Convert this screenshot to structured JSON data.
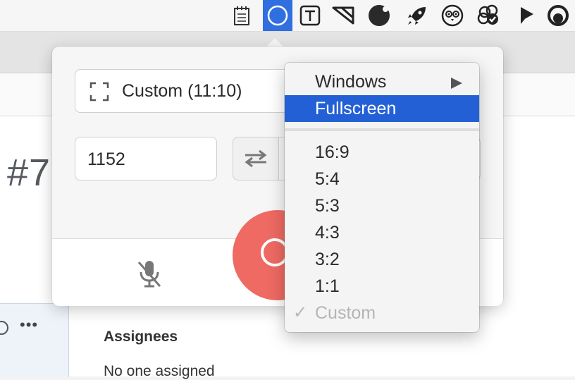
{
  "menubar": {
    "icons": [
      {
        "name": "notepad-icon"
      },
      {
        "name": "screen-recorder-icon",
        "active": true
      },
      {
        "name": "text-frame-icon"
      },
      {
        "name": "cut-shape-icon"
      },
      {
        "name": "black-circle-icon"
      },
      {
        "name": "rocket-icon"
      },
      {
        "name": "owl-icon"
      },
      {
        "name": "flower-check-icon"
      },
      {
        "name": "play-flag-icon"
      },
      {
        "name": "circle-status-icon"
      }
    ]
  },
  "background": {
    "title_fragment": "#7",
    "more_label": "•••",
    "assignees_heading": "Assignees",
    "assignees_value": "No one assigned"
  },
  "recorder": {
    "preset_label": "Custom (11:10)",
    "width_value": "1152",
    "record_color": "#ee6a62"
  },
  "menu": {
    "windows_label": "Windows",
    "fullscreen_label": "Fullscreen",
    "ratios": [
      "16:9",
      "5:4",
      "5:3",
      "4:3",
      "3:2",
      "1:1"
    ],
    "custom_label": "Custom",
    "check_mark": "✓",
    "highlight_color": "#2360d6"
  }
}
